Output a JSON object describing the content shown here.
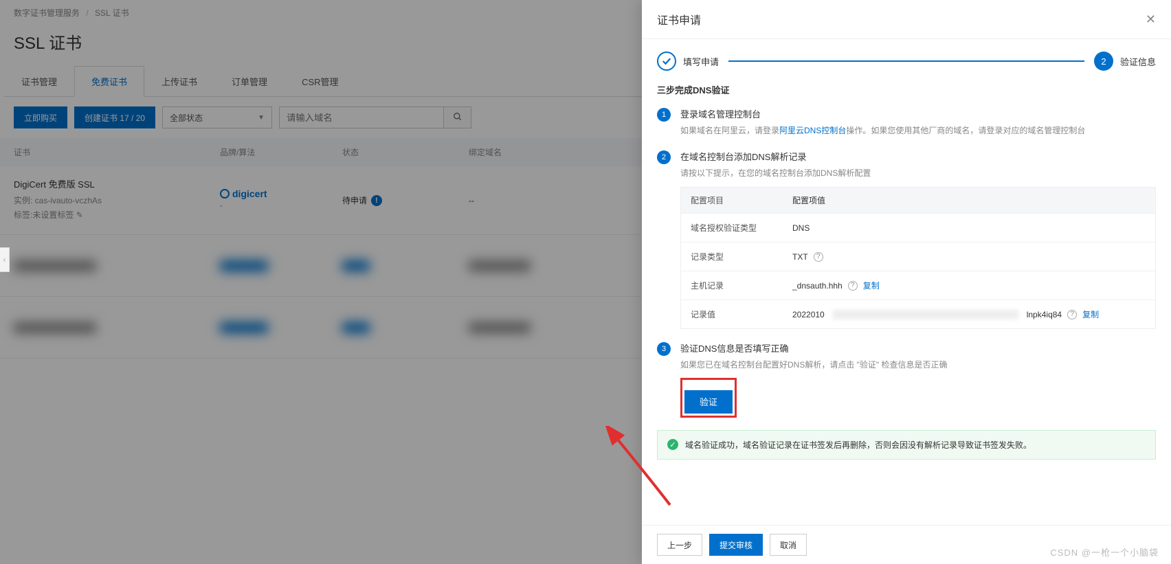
{
  "breadcrumb": {
    "root": "数字证书管理服务",
    "leaf": "SSL 证书"
  },
  "pageTitle": "SSL 证书",
  "tabs": [
    "证书管理",
    "免费证书",
    "上传证书",
    "订单管理",
    "CSR管理"
  ],
  "activeTab": 1,
  "toolbar": {
    "buy": "立即购买",
    "create": "创建证书 17 / 20",
    "statusFilter": "全部状态",
    "searchPlaceholder": "请输入域名"
  },
  "table": {
    "cols": [
      "证书",
      "品牌/算法",
      "状态",
      "绑定域名"
    ],
    "rows": [
      {
        "title": "DigiCert 免费版 SSL",
        "instance": "实例: cas-ivauto-vczhAs",
        "tags": "标签:未设置标签",
        "brandName": "digicert",
        "brandSep": "-",
        "status": "待申请",
        "statusIcon": "!",
        "domain": "--"
      }
    ]
  },
  "drawer": {
    "title": "证书申请",
    "steps": [
      {
        "label": "填写申请",
        "state": "done"
      },
      {
        "label": "验证信息",
        "state": "cur",
        "num": "2"
      }
    ],
    "subTitle": "三步完成DNS验证",
    "list": [
      {
        "n": "1",
        "h": "登录域名管理控制台",
        "descParts": {
          "p1": "如果域名在阿里云，请登录",
          "link": "阿里云DNS控制台",
          "p2": "操作。如果您使用其他厂商的域名，请登录对应的域名管理控制台"
        }
      },
      {
        "n": "2",
        "h": "在域名控制台添加DNS解析记录",
        "d": "请按以下提示，在您的域名控制台添加DNS解析配置",
        "cfgHeader": {
          "k": "配置项目",
          "v": "配置项值"
        },
        "cfg": [
          {
            "k": "域名授权验证类型",
            "v": "DNS"
          },
          {
            "k": "记录类型",
            "v": "TXT",
            "help": true
          },
          {
            "k": "主机记录",
            "v": "_dnsauth.hhh",
            "help": true,
            "copy": true
          },
          {
            "k": "记录值",
            "v_prefix": "2022010",
            "v_suffix": "lnpk4iq84",
            "help": true,
            "copy": true,
            "masked": true
          }
        ],
        "copyLabel": "复制"
      },
      {
        "n": "3",
        "h": "验证DNS信息是否填写正确",
        "d": "如果您已在域名控制台配置好DNS解析，请点击 \"验证\" 检查信息是否正确",
        "verifyBtn": "验证"
      }
    ],
    "success": "域名验证成功，域名验证记录在证书签发后再删除，否则会因没有解析记录导致证书签发失败。",
    "footer": {
      "back": "上一步",
      "submit": "提交审核",
      "cancel": "取消"
    }
  },
  "watermark": "CSDN @一枪一个小脑袋"
}
